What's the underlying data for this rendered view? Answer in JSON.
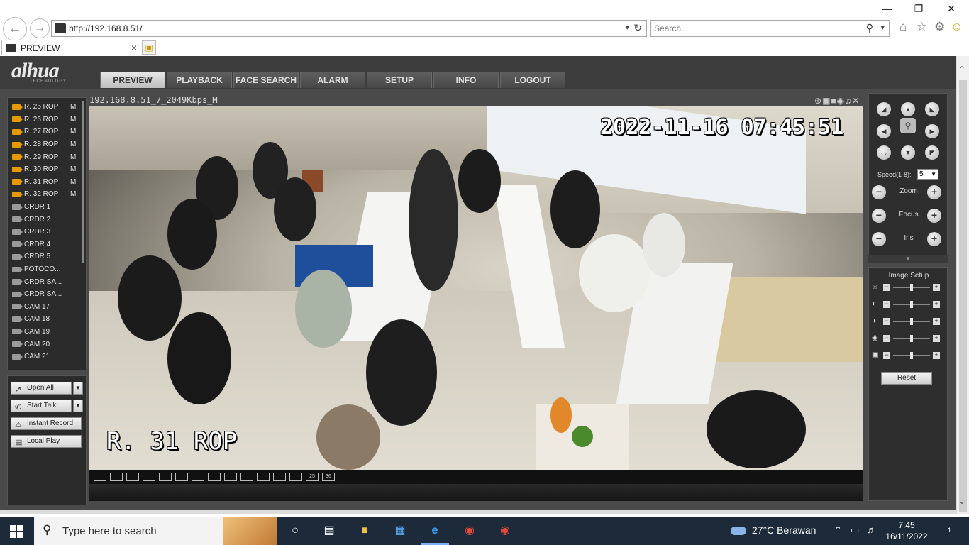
{
  "browser": {
    "url": "http://192.168.8.51/",
    "search_placeholder": "Search...",
    "tab_title": "PREVIEW"
  },
  "header": {
    "logo": "alhua",
    "logo_sub": "TECHNOLOGY",
    "menu": [
      "PREVIEW",
      "PLAYBACK",
      "FACE SEARCH",
      "ALARM",
      "SETUP",
      "INFO",
      "LOGOUT"
    ],
    "active_menu": "PREVIEW"
  },
  "channels": [
    {
      "name": "R. 25 ROP",
      "mode": "M",
      "active": true
    },
    {
      "name": "R. 26 ROP",
      "mode": "M",
      "active": true
    },
    {
      "name": "R. 27 ROP",
      "mode": "M",
      "active": true
    },
    {
      "name": "R. 28 ROP",
      "mode": "M",
      "active": true
    },
    {
      "name": "R. 29 ROP",
      "mode": "M",
      "active": true
    },
    {
      "name": "R. 30 ROP",
      "mode": "M",
      "active": true
    },
    {
      "name": "R. 31 ROP",
      "mode": "M",
      "active": true
    },
    {
      "name": "R. 32 ROP",
      "mode": "M",
      "active": true
    },
    {
      "name": "CRDR 1",
      "mode": "",
      "active": false
    },
    {
      "name": "CRDR 2",
      "mode": "",
      "active": false
    },
    {
      "name": "CRDR 3",
      "mode": "",
      "active": false
    },
    {
      "name": "CRDR 4",
      "mode": "",
      "active": false
    },
    {
      "name": "CRDR 5",
      "mode": "",
      "active": false
    },
    {
      "name": "POTOCO...",
      "mode": "",
      "active": false
    },
    {
      "name": "CRDR SA...",
      "mode": "",
      "active": false
    },
    {
      "name": "CRDR SA...",
      "mode": "",
      "active": false
    },
    {
      "name": "CAM 17",
      "mode": "",
      "active": false
    },
    {
      "name": "CAM 18",
      "mode": "",
      "active": false
    },
    {
      "name": "CAM 19",
      "mode": "",
      "active": false
    },
    {
      "name": "CAM 20",
      "mode": "",
      "active": false
    },
    {
      "name": "CAM 21",
      "mode": "",
      "active": false
    }
  ],
  "actions": {
    "open_all": "Open All",
    "start_talk": "Start Talk",
    "instant_record": "Instant Record",
    "local_play": "Local Play"
  },
  "video": {
    "title": "192.168.8.51_7_2049Kbps_M",
    "osd_time": "2022-11-16 07:45:51",
    "osd_name": "R. 31 ROP",
    "layout_buttons": [
      "",
      "",
      "",
      "",
      "",
      "",
      "",
      "",
      "",
      "",
      "",
      "",
      "",
      "25",
      "36"
    ]
  },
  "ptz": {
    "speed_label": "Speed(1-8):",
    "speed_value": "5",
    "zoom_label": "Zoom",
    "focus_label": "Focus",
    "iris_label": "Iris"
  },
  "image_setup": {
    "title": "Image Setup",
    "reset": "Reset",
    "slider_levels": [
      0.5,
      0.5,
      0.5,
      0.5,
      0.5
    ]
  },
  "taskbar": {
    "search_placeholder": "Type here to search",
    "weather": "27°C  Berawan",
    "time": "7:45",
    "date": "16/11/2022",
    "notifications": "1"
  }
}
